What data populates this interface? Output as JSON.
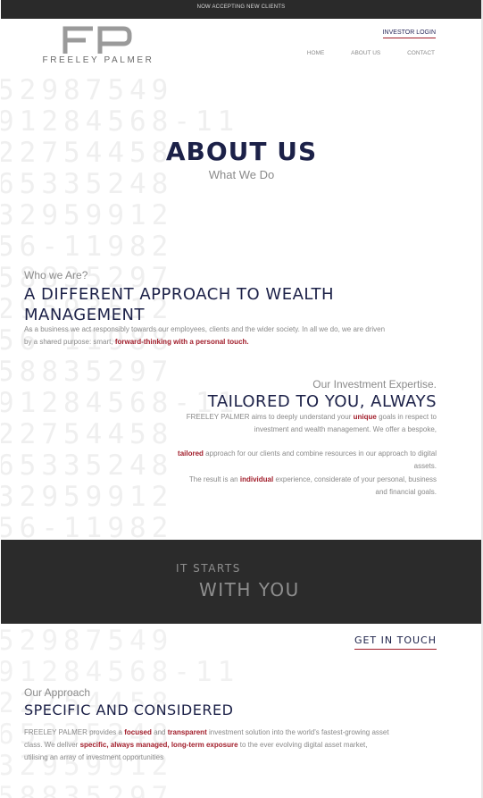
{
  "topbar": {
    "text": "NOW ACCEPTING NEW CLIENTS"
  },
  "brand": {
    "name": "FREELEY PALMER",
    "icon": "fp-monogram-logo"
  },
  "header": {
    "investor_login": "INVESTOR LOGIN",
    "nav": [
      "HOME",
      "ABOUT US",
      "CONTACT"
    ]
  },
  "hero": {
    "title": "ABOUT US",
    "subtitle": "What We Do"
  },
  "who": {
    "label": "Who we Are?",
    "heading": "A DIFFERENT APPROACH TO WEALTH MANAGEMENT",
    "text_before": "As a business we act responsibly towards our employees, clients and the wider society. In all we do, we are driven by a shared purpose: smart,",
    "text_highlight": "forward-thinking with a personal touch."
  },
  "expertise": {
    "label": "Our Investment Expertise.",
    "heading": "TAILORED TO YOU, ALWAYS",
    "p1_a": "FREELEY PALMER aims to deeply understand your",
    "p1_b": "unique",
    "p1_c": "goals in respect to investment and wealth management. We offer a bespoke,",
    "p1_d": "tailored",
    "p1_e": "approach for our clients and combine resources in our approach to digital assets.",
    "p2_a": "The result is an",
    "p2_b": "individual",
    "p2_c": "experience, considerate of your personal, business and financial goals."
  },
  "band": {
    "line1": "IT STARTS",
    "line2": "WITH YOU"
  },
  "contact": {
    "get_in_touch": "GET IN TOUCH"
  },
  "approach": {
    "label": "Our Approach",
    "heading": "SPECIFIC AND CONSIDERED",
    "t1": "FREELEY PALMER provides a",
    "t2": "focused",
    "t3": "and",
    "t4": "transparent",
    "t5": "investment solution into the world's fastest-growing asset class. We deliver",
    "t6": "specific, always managed, long-term exposure",
    "t7": "to the ever evolving digital asset market, utilising an array of investment opportunities"
  },
  "colors": {
    "navy": "#1c2148",
    "accent_red": "#a11d2a",
    "dark_band": "#2b2b2b",
    "muted_text": "#8a8a8a"
  }
}
